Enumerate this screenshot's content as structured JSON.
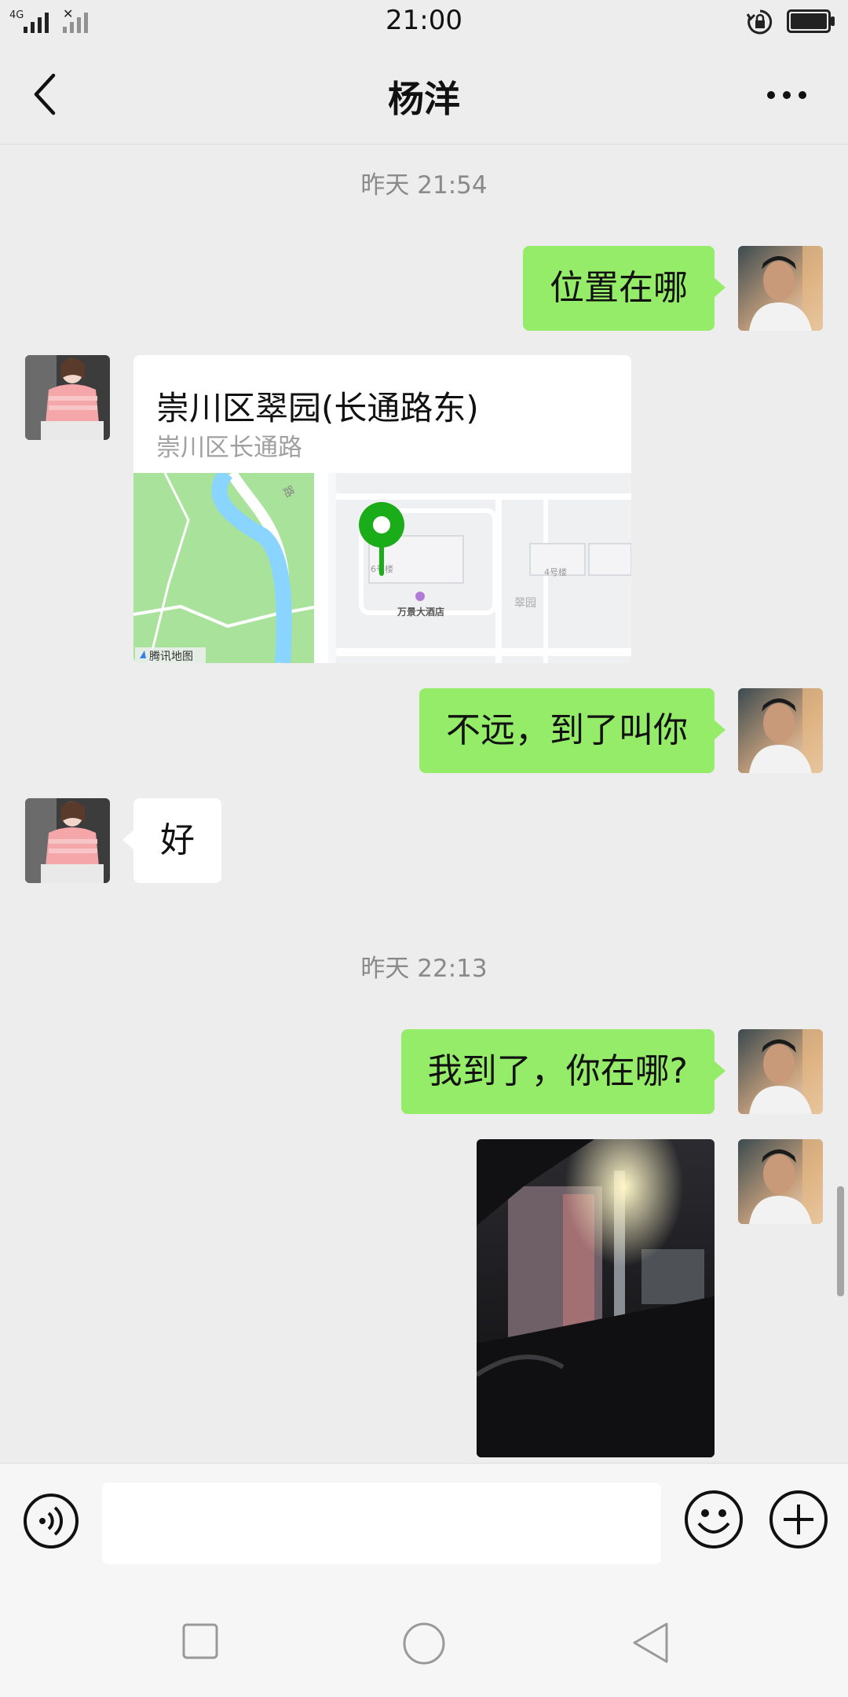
{
  "status_bar": {
    "time": "21:00",
    "network": "4G"
  },
  "header": {
    "title": "杨洋"
  },
  "messages": {
    "timestamp_1": "昨天 21:54",
    "m1": "位置在哪",
    "location": {
      "title": "崇川区翠园(长通路东)",
      "subtitle": "崇川区长通路",
      "map_labels": {
        "hotel": "万景大酒店",
        "building6": "6号楼",
        "building4": "4号楼",
        "area": "翠园",
        "road": "路",
        "provider": "腾讯地图"
      }
    },
    "m3": "不远，到了叫你",
    "m4": "好",
    "timestamp_2": "昨天 22:13",
    "m5": "我到了，你在哪?"
  },
  "input": {
    "placeholder": ""
  },
  "colors": {
    "bubble_me": "#95ec69",
    "bubble_them": "#ffffff",
    "background": "#ededed",
    "map_pin": "#1aad19"
  }
}
